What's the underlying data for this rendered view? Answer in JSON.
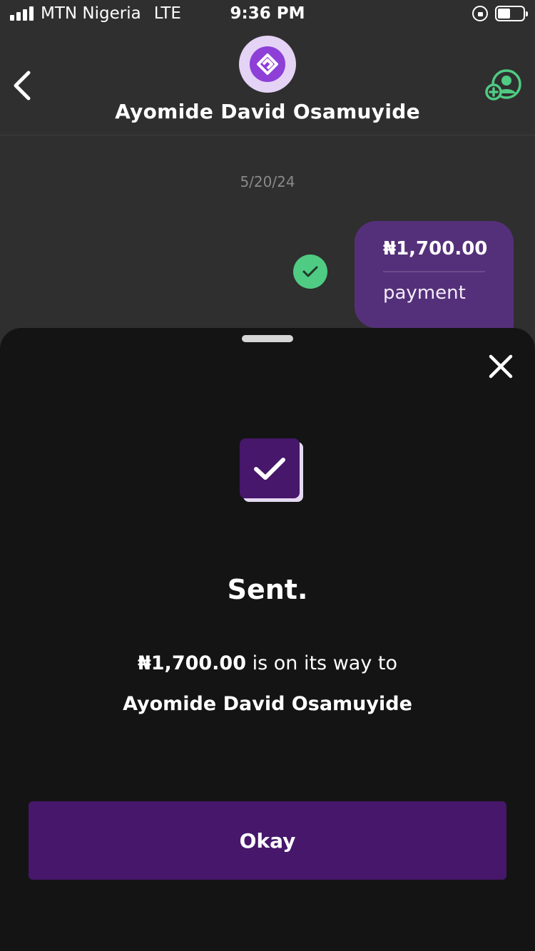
{
  "status_bar": {
    "carrier": "MTN Nigeria",
    "network": "LTE",
    "time": "9:36 PM",
    "battery_level": 0.5
  },
  "header": {
    "back_icon": "chevron-left-icon",
    "avatar_icon": "app-logo-icon",
    "contact_name": "Ayomide David Osamuyide",
    "add_contact_icon": "add-contact-icon",
    "accent_color": "#4fcb83"
  },
  "chat": {
    "date": "5/20/24",
    "status_icon": "check-circle-icon",
    "message": {
      "amount": "₦1,700.00",
      "note": "payment",
      "bubble_color": "#55307a"
    }
  },
  "sheet": {
    "close_icon": "close-icon",
    "success_icon": "checkbox-check-icon",
    "title": "Sent.",
    "amount": "₦1,700.00",
    "message_suffix": " is on its way to",
    "recipient": "Ayomide David Osamuyide",
    "okay_label": "Okay",
    "brand_color": "#46176a"
  }
}
